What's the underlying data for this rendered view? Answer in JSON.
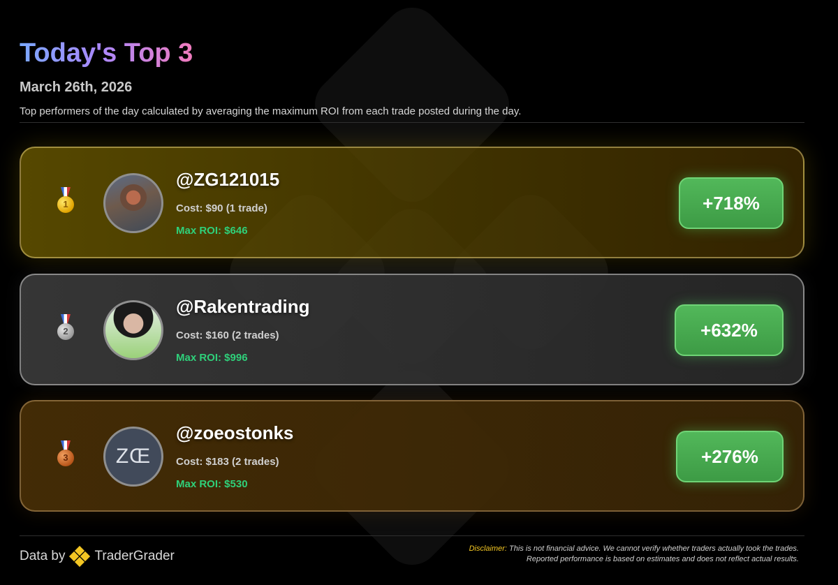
{
  "header": {
    "title": "Today's Top 3",
    "date": "March 26th, 2026",
    "description": "Top performers of the day calculated by averaging the maximum ROI from each trade posted during the day."
  },
  "traders": [
    {
      "rank": "1",
      "medal": "gold-medal-icon",
      "name": "@ZG121015",
      "cost": "Cost: $90 (1 trade)",
      "max_roi": "Max ROI: $646",
      "roi_percent": "+718%"
    },
    {
      "rank": "2",
      "medal": "silver-medal-icon",
      "name": "@Rakentrading",
      "cost": "Cost: $160 (2 trades)",
      "max_roi": "Max ROI: $996",
      "roi_percent": "+632%"
    },
    {
      "rank": "3",
      "medal": "bronze-medal-icon",
      "name": "@zoeostonks",
      "cost": "Cost: $183 (2 trades)",
      "max_roi": "Max ROI: $530",
      "roi_percent": "+276%",
      "avatar_logo_text": "ZŒ"
    }
  ],
  "footer": {
    "data_by_label": "Data by",
    "brand_name": "TraderGrader",
    "disclaimer_label": "Disclaimer:",
    "disclaimer_text": "This is not financial advice. We cannot verify whether traders actually took the trades. Reported performance is based on estimates and does not reflect actual results."
  },
  "colors": {
    "title_gradient": [
      "#7aa8ff",
      "#a989ff",
      "#f07bbd"
    ],
    "roi_green": "#2fd07a",
    "badge_green": "#4caf50",
    "brand_yellow": "#f3c623"
  }
}
